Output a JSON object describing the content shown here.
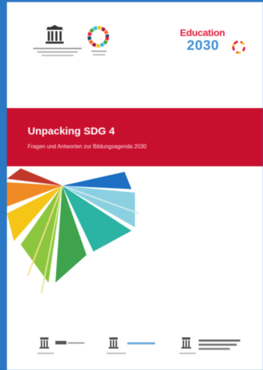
{
  "cover": {
    "title": "Unpacking SDG 4",
    "subtitle": "Fragen und Antworten zur Bildungsagenda 2030",
    "brand": {
      "word": "Education",
      "year": "2030",
      "word_color": "#e21b3c",
      "year_color": "#3d8fd6"
    },
    "banner_color": "#c8102e",
    "sidebar_color": "#2a77c4"
  },
  "icons": {
    "unesco_logo": "unesco-temple-logo",
    "sdg_wheel": "sdg-color-wheel",
    "fan": "color-fan-illustration"
  }
}
